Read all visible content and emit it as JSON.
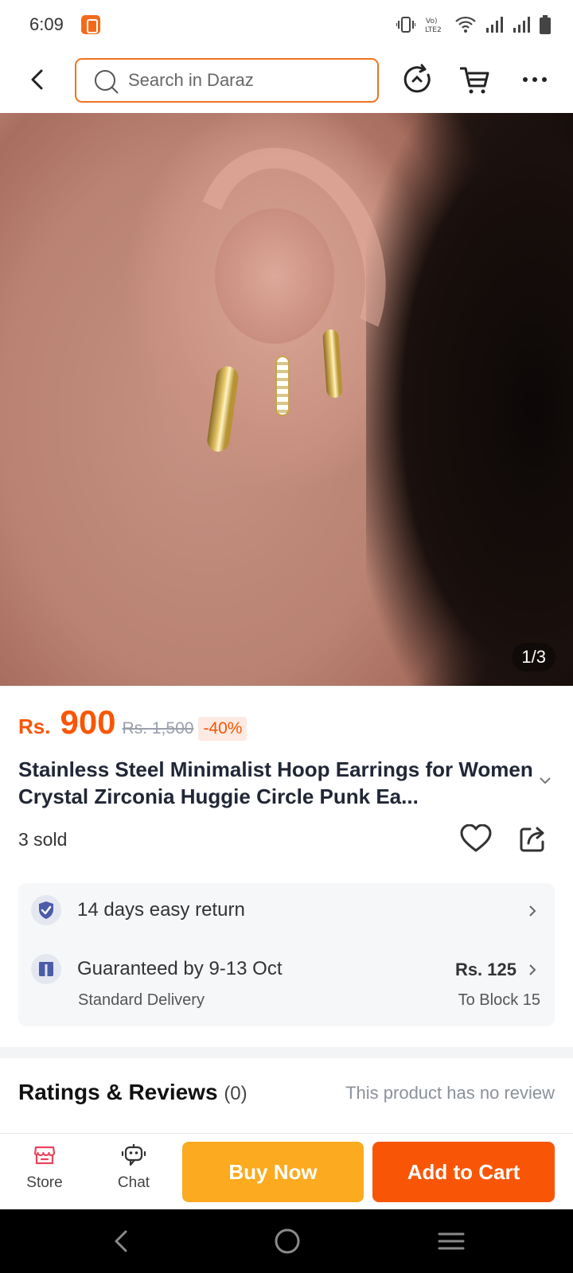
{
  "status_bar": {
    "time": "6:09",
    "app_icon": "daraz-app-icon",
    "icons": [
      "vibrate-icon",
      "volte-lte2-icon",
      "wifi-icon",
      "signal-icon",
      "signal-icon",
      "battery-icon"
    ],
    "volte_text": "Vo) LTE2"
  },
  "top_bar": {
    "back_icon": "back-arrow-icon",
    "search_placeholder": "Search in Daraz",
    "icons": [
      "history-icon",
      "cart-icon",
      "more-icon"
    ]
  },
  "gallery": {
    "counter": "1/3",
    "current_index": 1,
    "total": 3
  },
  "product": {
    "currency": "Rs.",
    "price": "900",
    "original_price": "Rs. 1,500",
    "discount": "-40%",
    "title": "Stainless Steel Minimalist Hoop Earrings for Women Crystal Zirconia Huggie Circle Punk Ea...",
    "sold": "3 sold"
  },
  "services": {
    "return_label": "14 days easy return",
    "delivery_label": "Guaranteed by 9-13 Oct",
    "delivery_type": "Standard Delivery",
    "delivery_fee": "Rs. 125",
    "delivery_location": "To Block 15"
  },
  "reviews": {
    "title": "Ratings & Reviews",
    "count": "(0)",
    "empty_text": "This product has no review"
  },
  "action_bar": {
    "store_label": "Store",
    "chat_label": "Chat",
    "buy_now_label": "Buy Now",
    "add_to_cart_label": "Add to Cart"
  },
  "colors": {
    "accent": "#f85606",
    "buy_now": "#fcaa1f",
    "search_border": "#f0731f"
  }
}
